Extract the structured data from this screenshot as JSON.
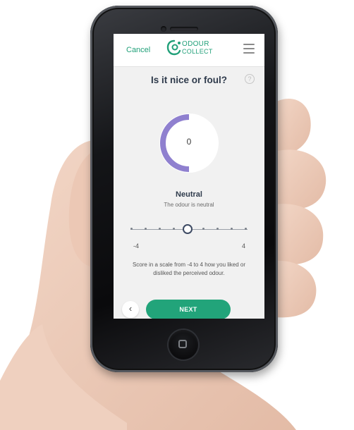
{
  "header": {
    "cancel_label": "Cancel",
    "logo_line1": "ODOUR",
    "logo_line2": "COLLECT"
  },
  "question": {
    "title": "Is it nice or foul?",
    "help_symbol": "?"
  },
  "gauge": {
    "value": "0",
    "color": "#8f80cf"
  },
  "rating": {
    "label": "Neutral",
    "description": "The odour is neutral"
  },
  "slider": {
    "min_label": "-4",
    "max_label": "4",
    "min": -4,
    "max": 4,
    "value": 0
  },
  "instruction": "Score in a scale from -4 to 4 how you liked or disliked the perceived odour.",
  "actions": {
    "back_symbol": "‹",
    "next_label": "NEXT"
  },
  "colors": {
    "accent": "#21a079",
    "title": "#2f3b4c"
  }
}
